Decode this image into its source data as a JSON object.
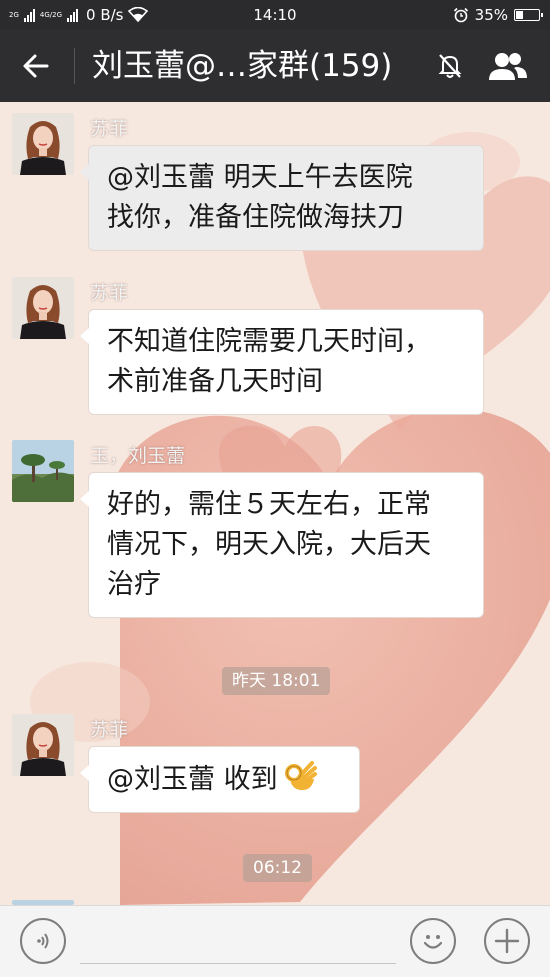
{
  "status_bar": {
    "sim1_label": "2G",
    "sim2_label": "4G/2G",
    "network_speed": "0 B/s",
    "time": "14:10",
    "battery_percent": "35%",
    "battery_level": 0.35,
    "icons": [
      "signal-icon",
      "wifi-icon",
      "alarm-icon",
      "battery-icon"
    ]
  },
  "header": {
    "title": "刘玉蕾@…家群(159)",
    "icons": [
      "back-arrow-icon",
      "mute-bell-icon",
      "group-members-icon"
    ]
  },
  "messages": [
    {
      "sender": "苏菲",
      "avatar": "woman-portrait",
      "lines": [
        "@刘玉蕾  明天上午去医院",
        "找你，准备住院做海扶刀"
      ],
      "highlighted": true
    },
    {
      "sender": "苏菲",
      "avatar": "woman-portrait",
      "lines": [
        "不知道住院需要几天时间，",
        "术前准备几天时间"
      ],
      "highlighted": false
    },
    {
      "sender": "玉，刘玉蕾",
      "avatar": "landscape-trees",
      "lines": [
        "好的，需住５天左右，正常",
        "情况下，明天入院，大后天",
        "治疗"
      ],
      "highlighted": false
    },
    {
      "sender": "苏菲",
      "avatar": "woman-portrait",
      "lines": [
        "@刘玉蕾  收到"
      ],
      "emoji": "ok-hand-emoji",
      "highlighted": false
    }
  ],
  "timestamps": [
    "昨天 18:01",
    "06:12"
  ],
  "input_bar": {
    "placeholder": "",
    "icons": [
      "voice-icon",
      "emoji-icon",
      "plus-icon"
    ]
  },
  "colors": {
    "header_bg": "#2e2e31",
    "chat_bg": "#f7e8df",
    "bubble_bg": "#ffffff",
    "highlight_bubble_bg": "#ececec",
    "heart_wallpaper": "#e9a596"
  }
}
